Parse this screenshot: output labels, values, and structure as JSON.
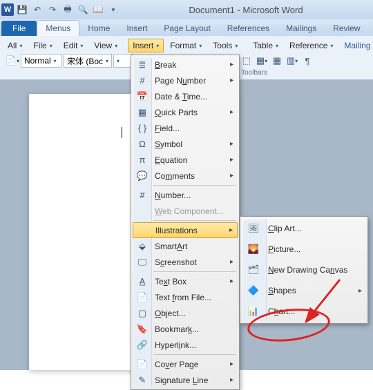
{
  "title": "Document1 - Microsoft Word",
  "tabs": {
    "file": "File",
    "menus": "Menus",
    "home": "Home",
    "insert": "Insert",
    "pagelayout": "Page Layout",
    "references": "References",
    "mailings": "Mailings",
    "review": "Review"
  },
  "menurow": {
    "all": "All",
    "file": "File",
    "edit": "Edit",
    "view": "View",
    "insert": "Insert",
    "format": "Format",
    "tools": "Tools",
    "table": "Table",
    "reference": "Reference",
    "mailing": "Mailing"
  },
  "style": {
    "normal": "Normal",
    "font": "宋体 (Boc"
  },
  "toolbars_label": "Toolbars",
  "insertmenu": {
    "break": "Break",
    "pagenum": "Page Number",
    "datetime": "Date & Time...",
    "quickparts": "Quick Parts",
    "field": "Field...",
    "symbol": "Symbol",
    "equation": "Equation",
    "comments": "Comments",
    "number": "Number...",
    "webcomp": "Web Component...",
    "illustrations": "Illustrations",
    "smartart": "SmartArt",
    "screenshot": "Screenshot",
    "textbox": "Text Box",
    "textfromfile": "Text from File...",
    "object": "Object...",
    "bookmark": "Bookmark...",
    "hyperlink": "Hyperlink...",
    "coverpage": "Cover Page",
    "sigline": "Signature Line"
  },
  "illus_sub": {
    "clipart": "Clip Art...",
    "picture": "Picture...",
    "canvas": "New Drawing Canvas",
    "shapes": "Shapes",
    "chart": "Chart..."
  }
}
